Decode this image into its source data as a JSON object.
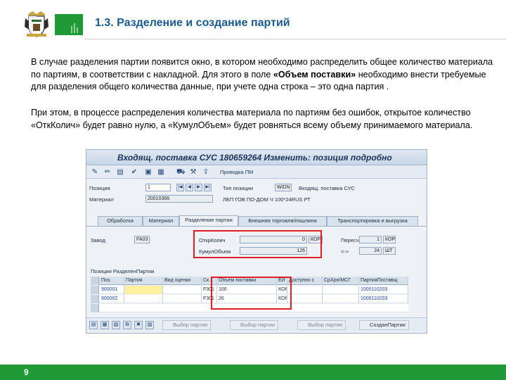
{
  "slide": {
    "title": "1.3. Разделение и создание партий",
    "page_number": "9"
  },
  "paragraph1": {
    "part1": "В случае разделения партии появится окно, в котором необходимо распределить общее количество материала по партиям, в соответствии с накладной. Для этого  в поле ",
    "bold": "«Объем поставки»",
    "part2": " необходимо внести требуемые для разделения общего количества данные, при учете одна строка – это одна партия ."
  },
  "paragraph2": "При этом, в процессе распределения количества материала по партиям без ошибок, открытое количество «ОткКолич» будет равно нулю, а «КумулОбъем» будет ровняться всему объему принимаемого материала.",
  "sap": {
    "window_title": "Входящ. поставка СУС 180659264 Изменить: позиция подробно",
    "toolbar": {
      "icons": [
        "pencil-glasses-icon",
        "pencil-icon",
        "document-icon",
        "check-icon",
        "disk-icon",
        "truck-icon",
        "tool-icon",
        "grid-icon",
        "export-icon"
      ],
      "text": "Проводка ПМ"
    },
    "position": {
      "label": "Позиция",
      "value": "1",
      "type_label": "Тип позиции",
      "type_value": "WIDN",
      "type_desc": "Входящ. поставка СУС"
    },
    "material": {
      "label": "Материал",
      "value": "20010366",
      "desc": "ЛБП ГОВ ПО-ДОМ Ч 100*24RUS РТ"
    },
    "tabs": [
      "Обработка",
      "Материал",
      "Разделение партии",
      "Внешняя торговля/пошлина",
      "Транспортировка и выгрузка"
    ],
    "active_tab": "Разделение партии",
    "plant": {
      "label": "Завод",
      "value": "FA03"
    },
    "open_qty": {
      "label": "ОткрКолич",
      "value": "0",
      "unit": "КОР"
    },
    "cum_qty": {
      "label": "КумулОбъем",
      "value": "126"
    },
    "conversion": {
      "label": "Пересч.",
      "qty1": "1",
      "unit1": "КОР",
      "arrow": "<->",
      "qty2": "24",
      "unit2": "ШТ"
    },
    "table": {
      "title": "Позиции РазделенПартии",
      "columns": [
        "Поз.",
        "Партия",
        "Вид оценки",
        "Ск...",
        "Объем поставки",
        "ЕИ",
        "Доступно с",
        "СрХрн/МСГ",
        "ПартияПоставщ"
      ],
      "rows": [
        {
          "pos": "900001",
          "batch": "",
          "valuation": "",
          "stock": "F301",
          "qty": "100",
          "unit": "КОР",
          "avail": "",
          "shelf": "",
          "vendor_batch": "1000110203"
        },
        {
          "pos": "900002",
          "batch": "",
          "valuation": "",
          "stock": "F301",
          "qty": "26",
          "unit": "КОР",
          "avail": "",
          "shelf": "",
          "vendor_batch": "1000110203"
        }
      ]
    },
    "bottom_buttons": {
      "select_batch_1": "Выбор партии",
      "select_batch_2": "Выбор партии",
      "select_batch_3": "Выбор партии",
      "create_batch": "СозданПартии"
    }
  },
  "colors": {
    "brand_green": "#1f9a36",
    "title_blue": "#1d5a8c",
    "highlight_red": "#e11d24"
  }
}
